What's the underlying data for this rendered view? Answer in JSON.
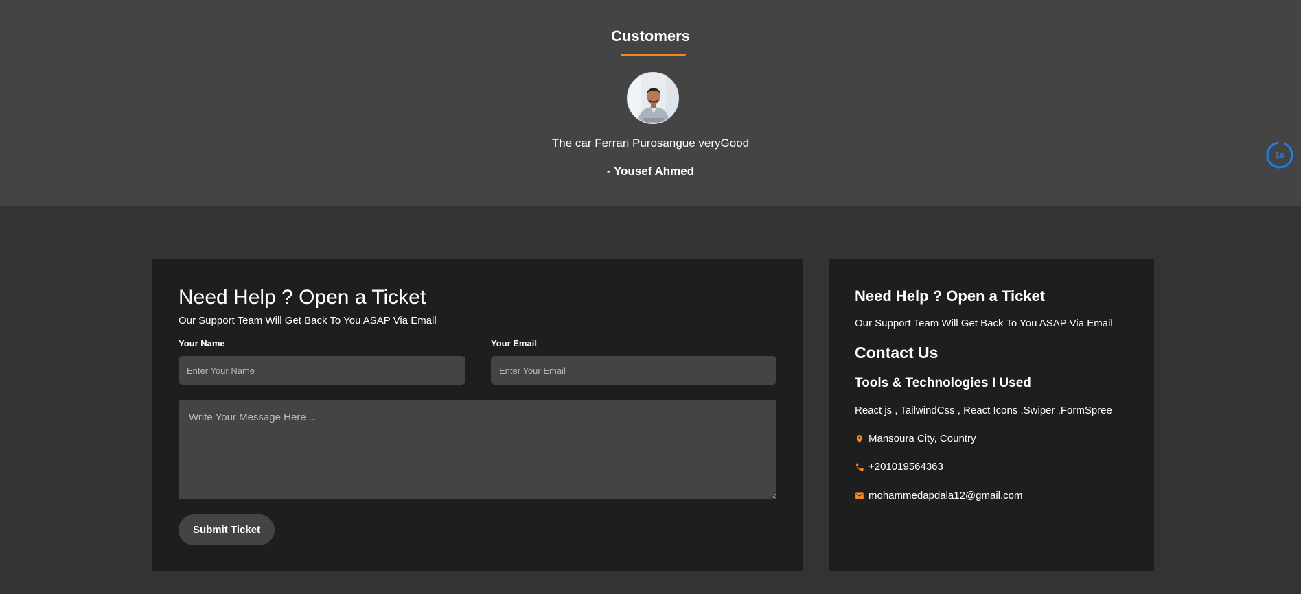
{
  "customers": {
    "title": "Customers",
    "quote": "The car Ferrari Purosangue veryGood",
    "author": "- Yousef Ahmed"
  },
  "timer": {
    "label": "1s",
    "accent": "#1c7ff0"
  },
  "ticket_form": {
    "heading": "Need Help ? Open a Ticket",
    "subheading": "Our Support Team Will Get Back To You ASAP Via Email",
    "name_label": "Your Name",
    "name_placeholder": "Enter Your Name",
    "email_label": "Your Email",
    "email_placeholder": "Enter Your Email",
    "message_placeholder": "Write Your Message Here ...",
    "submit_label": "Submit Ticket"
  },
  "info": {
    "heading": "Need Help ? Open a Ticket",
    "subheading": "Our Support Team Will Get Back To You ASAP Via Email",
    "contact_heading": "Contact Us",
    "tools_heading": "Tools & Technologies I Used",
    "tools": "React js , TailwindCss , React Icons ,Swiper ,FormSpree",
    "location": "Mansoura City, Country",
    "phone": "+201019564363",
    "email": "mohammedapdala12@gmail.com"
  },
  "colors": {
    "accent": "#f08a24",
    "card_bg": "#1e1e1e",
    "page_bg": "#333333",
    "section_bg": "#444444"
  },
  "icons": [
    "location-pin-icon",
    "phone-icon",
    "envelope-icon"
  ]
}
